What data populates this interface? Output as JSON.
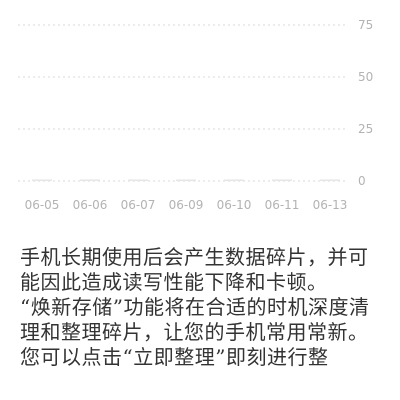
{
  "chart_data": {
    "type": "bar",
    "categories": [
      "06-05",
      "06-06",
      "06-07",
      "06-09",
      "06-10",
      "06-11",
      "06-13"
    ],
    "values": [
      0,
      0,
      0,
      0,
      0,
      0,
      0
    ],
    "ylim": [
      0,
      75
    ],
    "y_ticks": [
      "75",
      "50",
      "25",
      "0"
    ],
    "grid": true,
    "colors": {
      "grid": "#d9d9d9",
      "tick_text": "#b3b3b3",
      "bar": "#e6e6e6"
    }
  },
  "description": {
    "paragraphs": [
      "手机长期使用后会产生数据碎片，并可能因此造成读写性能下降和卡顿。",
      "“焕新存储”功能将在合适的时机深度清理和整理碎片，让您的手机常用常新。",
      "您可以点击“立即整理”即刻进行整"
    ],
    "color": "#333333"
  }
}
